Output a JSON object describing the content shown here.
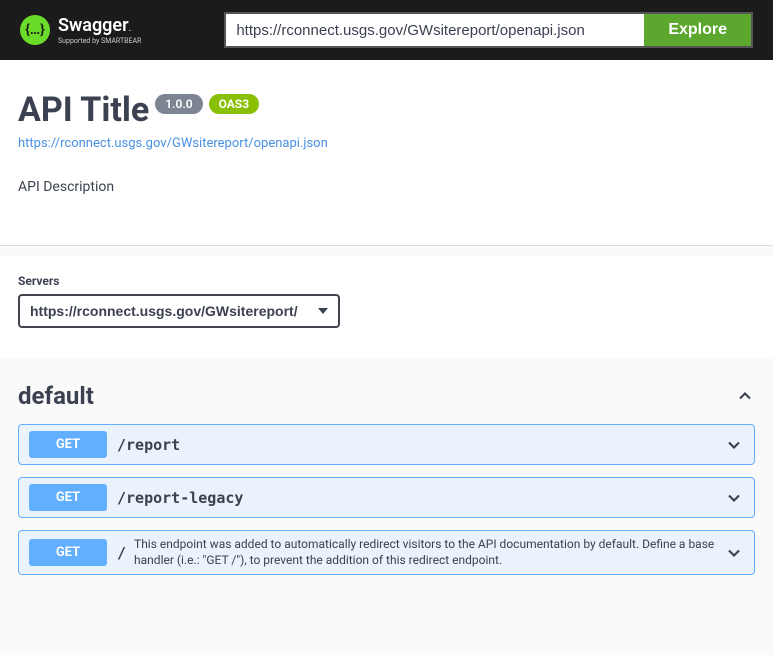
{
  "topbar": {
    "logo_text": "Swagger",
    "logo_sub": "Supported by SMARTBEAR",
    "url_value": "https://rconnect.usgs.gov/GWsitereport/openapi.json",
    "explore_label": "Explore"
  },
  "info": {
    "title": "API Title",
    "version": "1.0.0",
    "oas": "OAS3",
    "spec_url": "https://rconnect.usgs.gov/GWsitereport/openapi.json",
    "description": "API Description"
  },
  "servers": {
    "label": "Servers",
    "selected": "https://rconnect.usgs.gov/GWsitereport/"
  },
  "tag": {
    "name": "default"
  },
  "operations": [
    {
      "method": "GET",
      "path": "/report",
      "desc": ""
    },
    {
      "method": "GET",
      "path": "/report-legacy",
      "desc": ""
    },
    {
      "method": "GET",
      "path": "/",
      "desc": "This endpoint was added to automatically redirect visitors to the API documentation by default. Define a base handler (i.e.: \"GET /\"), to prevent the addition of this redirect endpoint."
    }
  ]
}
